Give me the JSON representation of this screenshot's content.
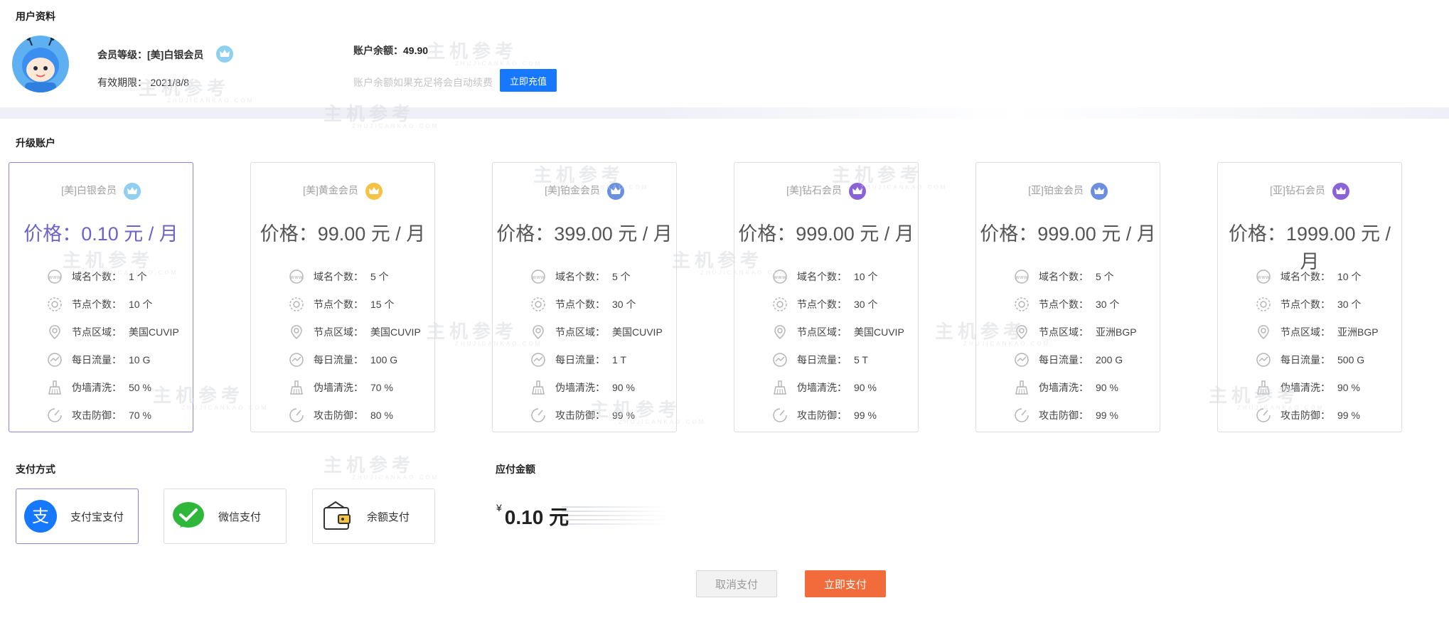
{
  "profile": {
    "section_title": "用户资料",
    "level_label": "会员等级：",
    "level_value": "[美]白银会员",
    "expiry_label": "有效期限：",
    "expiry_value": "2021/8/8",
    "balance_label": "账户余额：",
    "balance_value": "49.90",
    "auto_renew_hint": "账户余额如果充足将会自动续费",
    "recharge_button": "立即充值"
  },
  "upgrade": {
    "section_title": "升级账户",
    "plans": [
      {
        "name": "[美]白银会员",
        "price": "价格：0.10 元 / 月",
        "crown_color": "#8fd0f0",
        "features": [
          "1 个",
          "10 个",
          "美国CUVIP",
          "10 G",
          "50 %",
          "70 %"
        ]
      },
      {
        "name": "[美]黄金会员",
        "price": "价格：99.00 元 / 月",
        "crown_color": "#f5c243",
        "features": [
          "5 个",
          "15 个",
          "美国CUVIP",
          "100 G",
          "70 %",
          "80 %"
        ]
      },
      {
        "name": "[美]铂金会员",
        "price": "价格：399.00 元 / 月",
        "crown_color": "#6a8fe0",
        "features": [
          "5 个",
          "30 个",
          "美国CUVIP",
          "1 T",
          "90 %",
          "99 %"
        ]
      },
      {
        "name": "[美]钻石会员",
        "price": "价格：999.00 元 / 月",
        "crown_color": "#8a63d8",
        "features": [
          "10 个",
          "30 个",
          "美国CUVIP",
          "5 T",
          "90 %",
          "99 %"
        ]
      },
      {
        "name": "[亚]铂金会员",
        "price": "价格：999.00 元 / 月",
        "crown_color": "#6a8fe0",
        "features": [
          "5 个",
          "30 个",
          "亚洲BGP",
          "200 G",
          "90 %",
          "99 %"
        ]
      },
      {
        "name": "[亚]钻石会员",
        "price": "价格：1999.00 元 / 月",
        "crown_color": "#8a63d8",
        "features": [
          "10 个",
          "30 个",
          "亚洲BGP",
          "500 G",
          "90 %",
          "99 %"
        ]
      }
    ],
    "feature_labels": [
      "域名个数：",
      "节点个数：",
      "节点区域：",
      "每日流量：",
      "伪墙清洗：",
      "攻击防御："
    ],
    "feature_icons": [
      "www-icon",
      "node-icon",
      "location-icon",
      "traffic-icon",
      "broom-icon",
      "shield-icon"
    ]
  },
  "payment": {
    "section_title": "支付方式",
    "methods": [
      {
        "label": "支付宝支付",
        "icon": "alipay-icon"
      },
      {
        "label": "微信支付",
        "icon": "wechat-icon"
      },
      {
        "label": "余额支付",
        "icon": "wallet-icon"
      }
    ],
    "amount_title": "应付金额",
    "currency": "¥",
    "amount": "0.10 元",
    "cancel_button": "取消支付",
    "pay_button": "立即支付"
  },
  "watermark": {
    "text": "主机参考",
    "sub": "ZHUJICANKAO.COM"
  },
  "colors": {
    "primary": "#1677ff",
    "accent": "#f26b3a",
    "selected_border": "#8b83d6"
  }
}
